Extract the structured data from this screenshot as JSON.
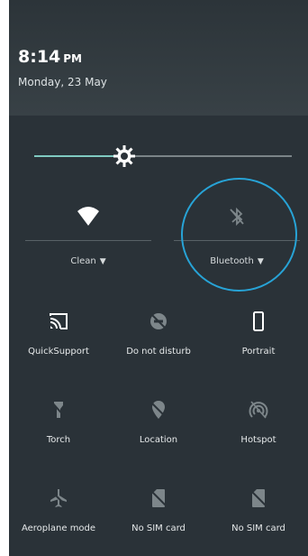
{
  "status": {
    "time": "8:14",
    "ampm": "PM",
    "date": "Monday, 23 May"
  },
  "brightness": {
    "level": 0.35,
    "icon": "brightness-icon"
  },
  "toggles": {
    "wifi": {
      "label": "Clean",
      "icon": "wifi-icon"
    },
    "bluetooth": {
      "label": "Bluetooth",
      "icon": "bluetooth-off-icon"
    }
  },
  "tiles": [
    {
      "label": "QuickSupport",
      "icon": "cast-icon"
    },
    {
      "label": "Do not disturb",
      "icon": "do-not-disturb-icon"
    },
    {
      "label": "Portrait",
      "icon": "phone-portrait-icon"
    },
    {
      "label": "Torch",
      "icon": "torch-off-icon"
    },
    {
      "label": "Location",
      "icon": "location-off-icon"
    },
    {
      "label": "Hotspot",
      "icon": "hotspot-off-icon"
    },
    {
      "label": "Aeroplane mode",
      "icon": "airplane-off-icon"
    },
    {
      "label": "No SIM card",
      "icon": "no-sim-icon"
    },
    {
      "label": "No SIM card",
      "icon": "no-sim-icon"
    }
  ],
  "colors": {
    "panel": "#2a3238",
    "accent": "#7fc9c0",
    "highlight": "#27a3d6",
    "dim": "#7d868a"
  }
}
